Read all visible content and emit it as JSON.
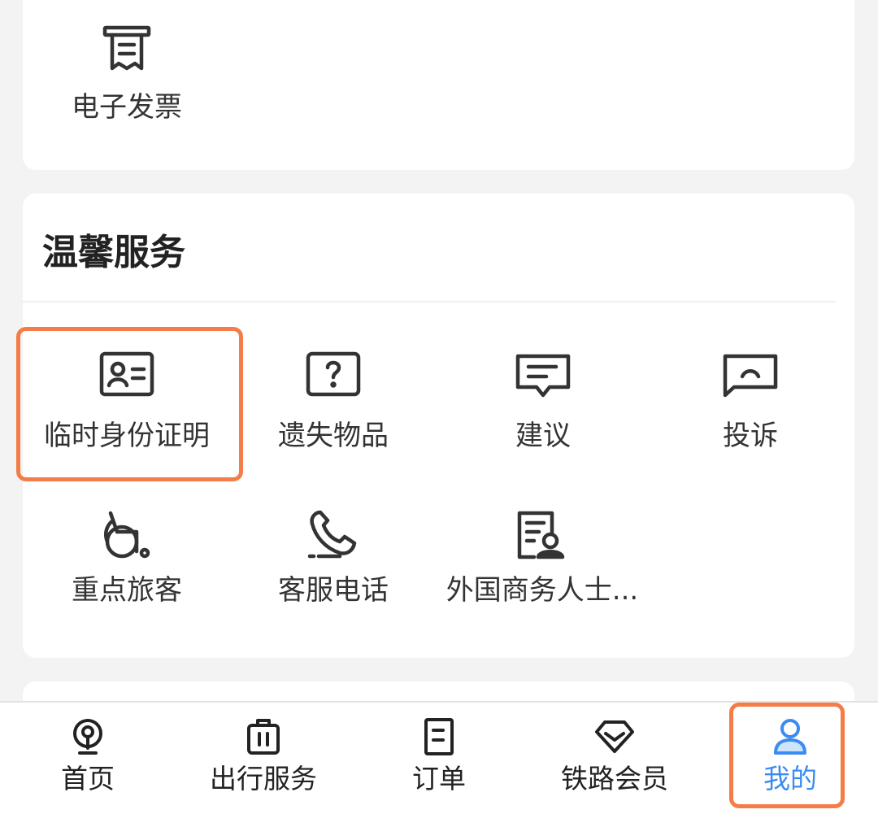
{
  "top_section": {
    "items": [
      {
        "label": "电子发票",
        "icon": "receipt-icon"
      }
    ]
  },
  "warm_service": {
    "title": "温馨服务",
    "items": [
      {
        "label": "临时身份证明",
        "icon": "id-card-icon"
      },
      {
        "label": "遗失物品",
        "icon": "question-box-icon"
      },
      {
        "label": "建议",
        "icon": "message-lines-icon"
      },
      {
        "label": "投诉",
        "icon": "sad-message-icon"
      },
      {
        "label": "重点旅客",
        "icon": "wheelchair-icon"
      },
      {
        "label": "客服电话",
        "icon": "phone-icon"
      },
      {
        "label": "外国商务人士...",
        "icon": "document-person-icon"
      }
    ]
  },
  "tabbar": {
    "items": [
      {
        "label": "首页",
        "icon": "railway-logo-icon"
      },
      {
        "label": "出行服务",
        "icon": "luggage-icon"
      },
      {
        "label": "订单",
        "icon": "order-document-icon"
      },
      {
        "label": "铁路会员",
        "icon": "diamond-icon"
      },
      {
        "label": "我的",
        "icon": "user-icon"
      }
    ],
    "active_index": 4
  },
  "colors": {
    "accent": "#3b8cf0",
    "highlight": "#f47c46",
    "background": "#f3f3f3"
  }
}
